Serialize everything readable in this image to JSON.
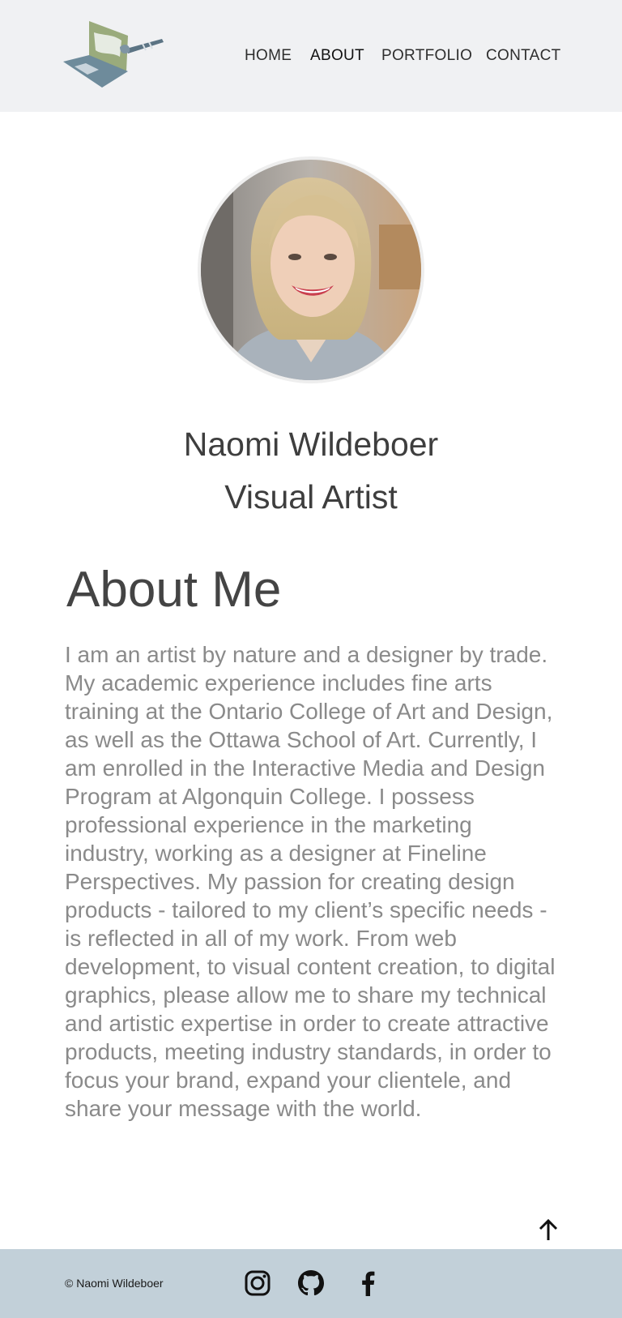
{
  "header": {
    "logo_icon": "laptop-paintbrush-logo",
    "nav": [
      {
        "label": "HOME",
        "active": false
      },
      {
        "label": "ABOUT",
        "active": true
      },
      {
        "label": "PORTFOLIO",
        "active": false
      },
      {
        "label": "CONTACT",
        "active": false
      }
    ]
  },
  "profile": {
    "photo_icon": "portrait-photo",
    "name": "Naomi Wildeboer",
    "role": "Visual Artist"
  },
  "about": {
    "heading": "About Me",
    "body": "I am an artist by nature and a designer by trade. My academic experience includes fine arts training at the Ontario College of Art and Design, as well as the Ottawa School of Art. Currently, I am enrolled in the Interactive Media and Design Program at Algonquin College. I possess professional experience in the marketing industry, working as a designer at Fineline Perspectives. My passion for creating design products - tailored to my client’s specific needs - is reflected in all of my work. From web development, to visual content creation, to digital graphics, please allow me to share my technical and artistic expertise in order to create attractive products, meeting industry standards, in order to focus your brand, expand your clientele, and share your message with the world."
  },
  "back_to_top_icon": "arrow-up-icon",
  "footer": {
    "copyright": "© Naomi Wildeboer",
    "social": [
      {
        "icon": "instagram-icon"
      },
      {
        "icon": "github-icon"
      },
      {
        "icon": "facebook-icon"
      }
    ]
  },
  "colors": {
    "header_bg": "#f0f1f3",
    "footer_bg": "#c2d0d9",
    "logo_green": "#9aab7c",
    "logo_blue": "#6e8b9b"
  }
}
